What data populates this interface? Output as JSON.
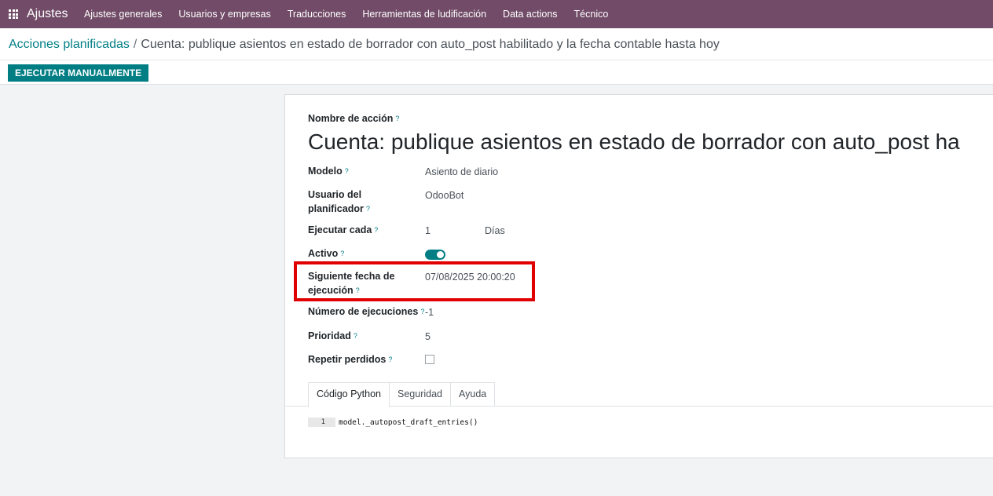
{
  "navbar": {
    "app_name": "Ajustes",
    "menu": [
      "Ajustes generales",
      "Usuarios y empresas",
      "Traducciones",
      "Herramientas de ludificación",
      "Data actions",
      "Técnico"
    ],
    "color": "#714b67"
  },
  "breadcrumb": {
    "parent": "Acciones planificadas",
    "separator": "/",
    "current": "Cuenta: publique asientos en estado de borrador con auto_post habilitado y la fecha contable hasta hoy"
  },
  "toolbar": {
    "run_label": "EJECUTAR MANUALMENTE",
    "accent": "#017e84"
  },
  "form": {
    "action_name_label": "Nombre de acción",
    "action_name": "Cuenta: publique asientos en estado de borrador con auto_post ha",
    "help_mark": "?",
    "fields": {
      "model": {
        "label": "Modelo",
        "value": "Asiento de diario"
      },
      "user": {
        "label_line1": "Usuario del",
        "label_line2": "planificador",
        "value": "OdooBot"
      },
      "interval": {
        "label": "Ejecutar cada",
        "number": "1",
        "unit": "Días"
      },
      "active": {
        "label": "Activo",
        "value": true
      },
      "nextcall": {
        "label_line1": "Siguiente fecha de",
        "label_line2": "ejecución",
        "value": "07/08/2025 20:00:20"
      },
      "numbercall": {
        "label": "Número de ejecuciones",
        "value": "-1"
      },
      "priority": {
        "label": "Prioridad",
        "value": "5"
      },
      "doall": {
        "label": "Repetir perdidos",
        "value": false
      }
    },
    "tabs": [
      "Código Python",
      "Seguridad",
      "Ayuda"
    ],
    "active_tab": "Código Python",
    "code": {
      "line_number": "1",
      "line": "model._autopost_draft_entries()"
    }
  },
  "annotation": {
    "highlight_color": "#e00000"
  }
}
